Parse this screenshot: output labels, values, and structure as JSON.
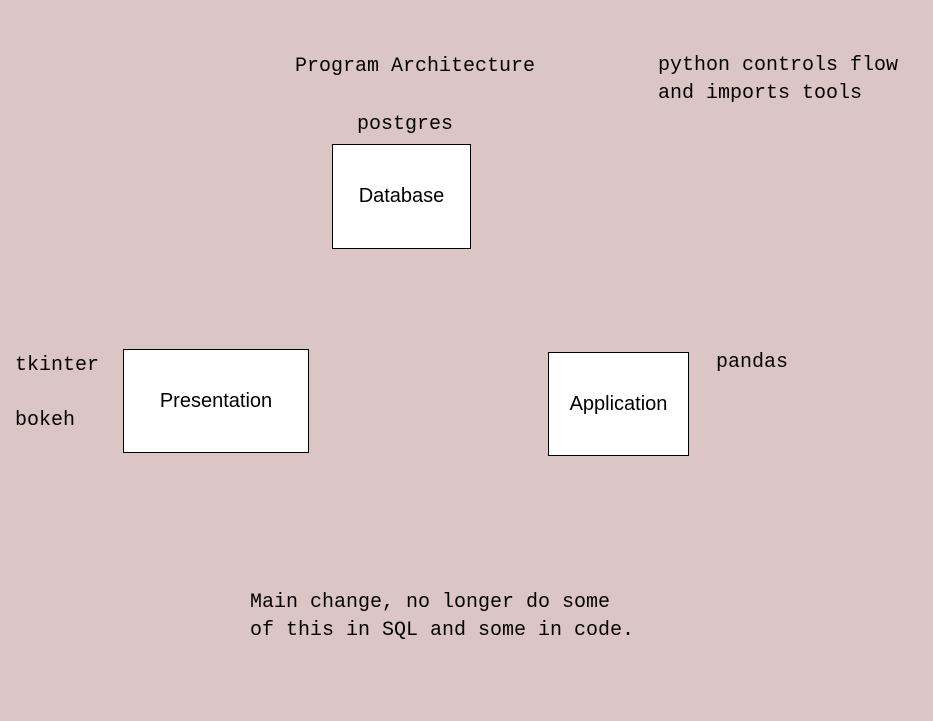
{
  "title": "Program Architecture",
  "top_note_line1": "python controls flow",
  "top_note_line2": "and imports tools",
  "boxes": {
    "database": {
      "label": "Database",
      "caption": "postgres"
    },
    "presentation": {
      "label": "Presentation",
      "captions": {
        "a": "tkinter",
        "b": "bokeh"
      }
    },
    "application": {
      "label": "Application",
      "caption": "pandas"
    }
  },
  "bottom_note_line1": "Main change, no longer do some",
  "bottom_note_line2": "of this in SQL and some in code."
}
